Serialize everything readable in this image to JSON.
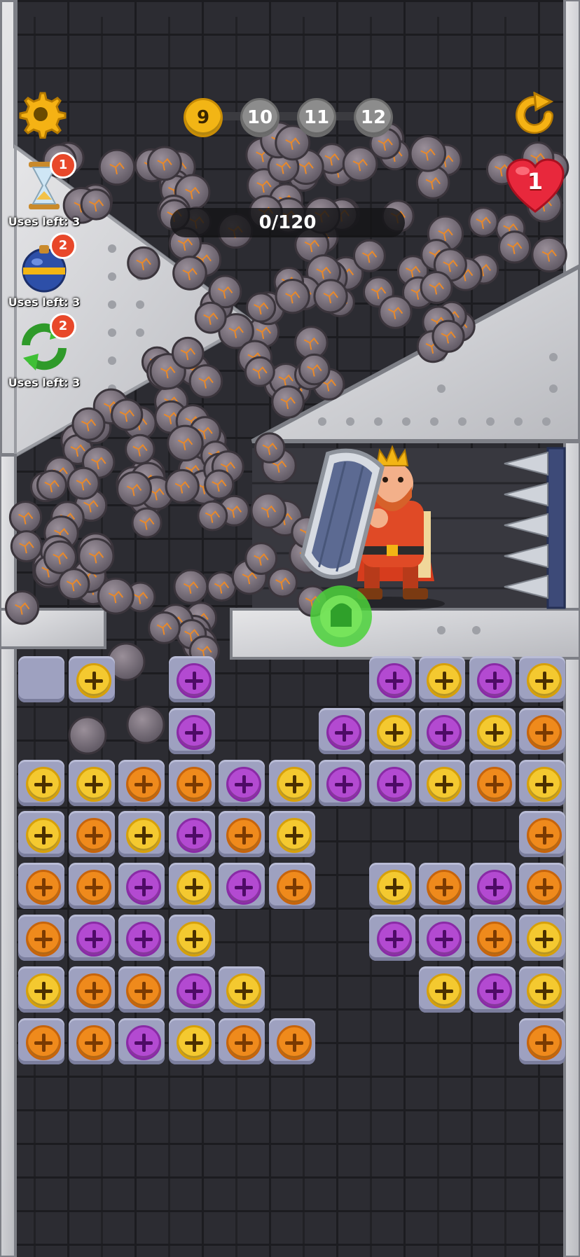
{
  "hud": {
    "settings_icon": "gear-icon",
    "restart_icon": "restart-arrow-icon",
    "levels": [
      "9",
      "10",
      "11",
      "12"
    ],
    "current_level": "9",
    "progress_text": "0/120",
    "lives": "1",
    "colors": {
      "gold": "#f2b515",
      "heart": "#e8283c"
    }
  },
  "boosters": [
    {
      "icon": "hourglass-icon",
      "badge": "1",
      "uses": "Uses left: 3"
    },
    {
      "icon": "bomb-icon",
      "badge": "2",
      "uses": "Uses left: 3"
    },
    {
      "icon": "shuffle-arrows-icon",
      "badge": "2",
      "uses": "Uses left: 3"
    }
  ],
  "board": {
    "screw_colors": {
      "yellow": "#f4c930",
      "orange": "#ef8a1c",
      "purple": "#b34ad1"
    },
    "rows": [
      [
        "empty",
        "yellow",
        null,
        "purple",
        null,
        null,
        null,
        "purple",
        "yellow",
        "purple",
        "yellow"
      ],
      [
        null,
        null,
        null,
        "purple",
        null,
        null,
        "purple",
        "yellow",
        "purple",
        "yellow",
        "orange"
      ],
      [
        "yellow",
        "yellow",
        "orange",
        "orange",
        "purple",
        "yellow",
        "purple",
        "purple",
        "yellow",
        "orange",
        "yellow"
      ],
      [
        "yellow",
        "orange",
        "yellow",
        "purple",
        "orange",
        "yellow",
        null,
        null,
        null,
        null,
        "orange"
      ],
      [
        "orange",
        "orange",
        "purple",
        "yellow",
        "purple",
        "orange",
        null,
        "yellow",
        "orange",
        "purple",
        "orange"
      ],
      [
        "orange",
        "purple",
        "purple",
        "yellow",
        null,
        null,
        null,
        "purple",
        "purple",
        "orange",
        "yellow"
      ],
      [
        "yellow",
        "orange",
        "orange",
        "purple",
        "yellow",
        null,
        null,
        null,
        "yellow",
        "purple",
        "yellow"
      ],
      [
        "orange",
        "orange",
        "purple",
        "yellow",
        "orange",
        "orange",
        null,
        null,
        null,
        null,
        "orange"
      ]
    ]
  },
  "scene": {
    "king": "king-with-shield",
    "spikes": "spike-wall",
    "pin": "green-pull-pin-icon",
    "rock_color": "#7d747e",
    "crack_color": "#e8892a"
  }
}
